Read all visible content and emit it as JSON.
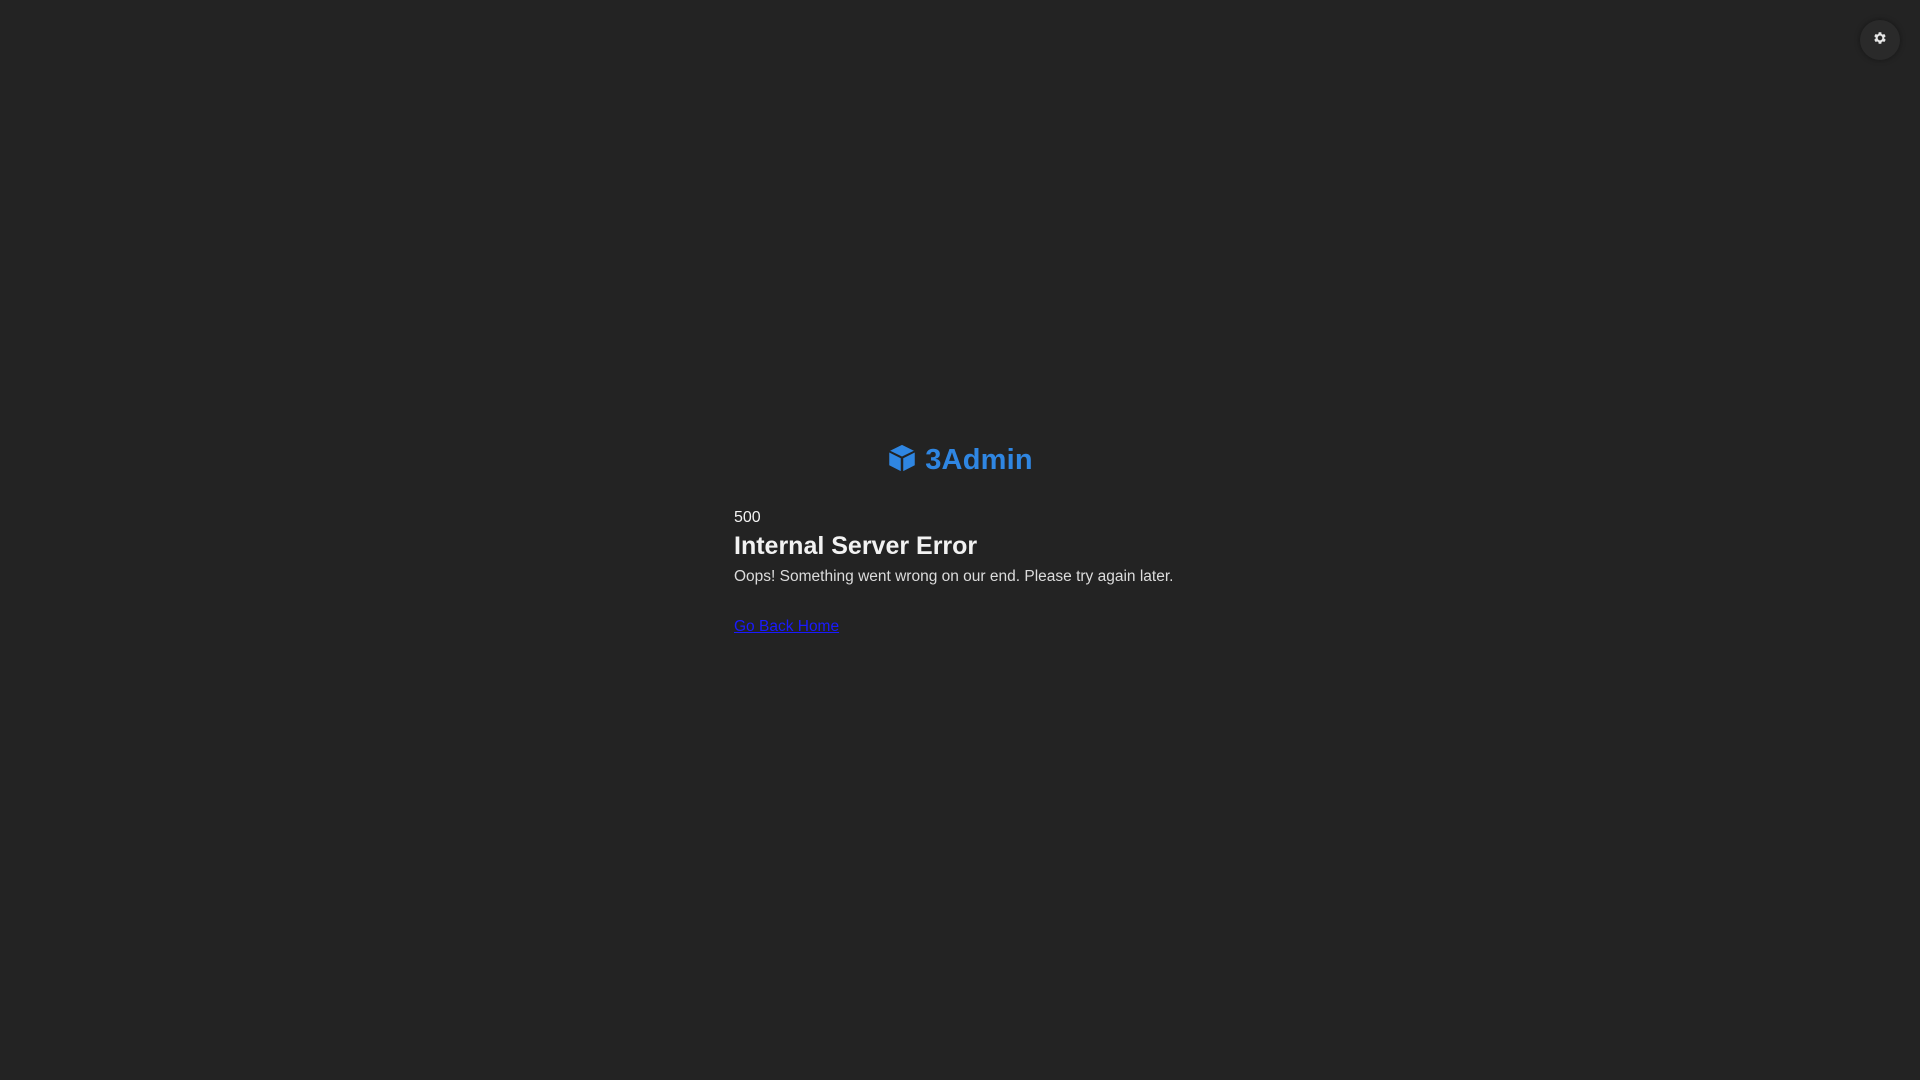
{
  "theme_toggle": {
    "icon": "gear-icon"
  },
  "brand": {
    "icon": "cube-icon",
    "name": "3Admin",
    "color": "#2f86e2"
  },
  "error": {
    "code": "500",
    "title": "Internal Server Error",
    "message": "Oops! Something went wrong on our end. Please try again later.",
    "home_link": "Go Back Home"
  },
  "colors": {
    "background": "#232323",
    "link": "#1a1aff"
  }
}
